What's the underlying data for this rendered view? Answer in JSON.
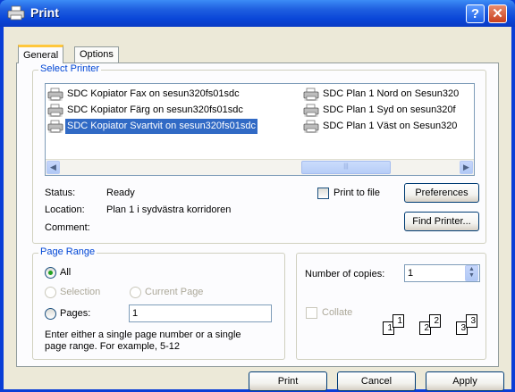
{
  "window": {
    "title": "Print"
  },
  "tabs": [
    {
      "label": "General"
    },
    {
      "label": "Options"
    }
  ],
  "select_printer": {
    "label": "Select Printer",
    "printers": [
      {
        "name": "SDC Kopiator Fax on sesun320fs01sdc"
      },
      {
        "name": "SDC Kopiator Färg on sesun320fs01sdc"
      },
      {
        "name": "SDC Kopiator Svartvit on sesun320fs01sdc"
      },
      {
        "name": "SDC Plan 1 Nord on Sesun320"
      },
      {
        "name": "SDC Plan 1 Syd on sesun320f"
      },
      {
        "name": "SDC Plan 1 Väst on Sesun320"
      }
    ],
    "selected_printer": "SDC Kopiator Svartvit on sesun320fs01sdc",
    "status_label": "Status:",
    "status_value": "Ready",
    "location_label": "Location:",
    "location_value": "Plan 1 i sydvästra korridoren",
    "comment_label": "Comment:",
    "comment_value": "",
    "print_to_file_label": "Print to file",
    "print_to_file_checked": false,
    "preferences_button": "Preferences",
    "find_printer_button": "Find Printer..."
  },
  "page_range": {
    "label": "Page Range",
    "all_label": "All",
    "selection_label": "Selection",
    "current_page_label": "Current Page",
    "pages_label": "Pages:",
    "pages_value": "1",
    "selected_option": "All",
    "hint_line1": "Enter either a single page number or a single",
    "hint_line2": "page range.  For example, 5-12"
  },
  "copies": {
    "number_label": "Number of copies:",
    "number_value": "1",
    "collate_label": "Collate",
    "collate_checked": false,
    "collate_pages": [
      "1",
      "1",
      "2",
      "2",
      "3",
      "3"
    ]
  },
  "buttons": {
    "print": "Print",
    "cancel": "Cancel",
    "apply": "Apply"
  },
  "colors": {
    "title_bar": "#0a46d8",
    "group_label": "#0046d5",
    "selection": "#316ac5",
    "dialog_bg": "#ece9d8"
  }
}
